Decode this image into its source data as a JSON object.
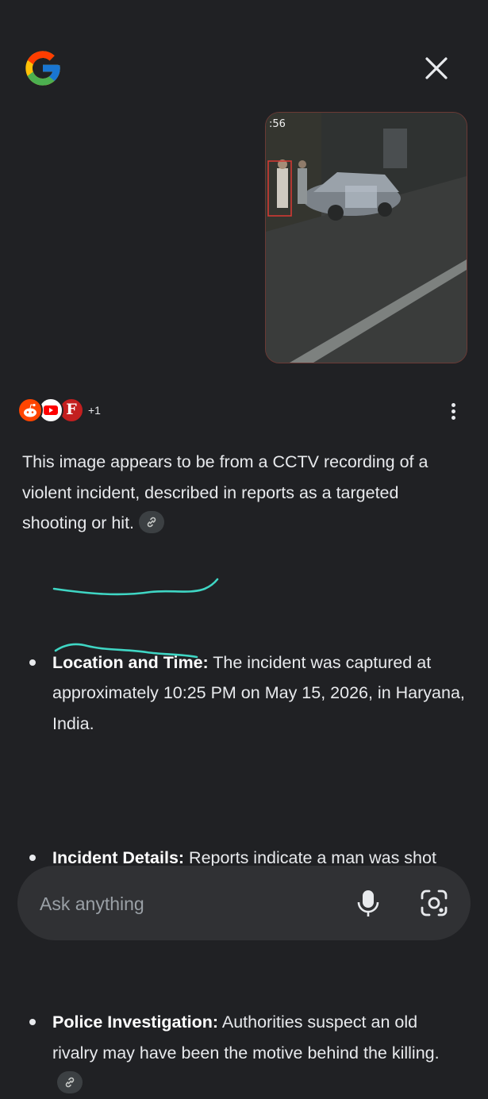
{
  "header": {
    "logo_icon": "google-g-icon",
    "close_icon": "close-icon"
  },
  "user_image": {
    "timestamp": ":56",
    "description_icon": "cctv-image"
  },
  "sources": {
    "icons": [
      "reddit-icon",
      "youtube-icon",
      "forbes-icon"
    ],
    "forbes_letter": "F",
    "more_count": "+1"
  },
  "answer": {
    "intro": "This image appears to be from a CCTV recording of a violent incident, described in reports as a targeted shooting or hit.",
    "bullets": [
      {
        "title": "Location and Time:",
        "text": " The incident was captured at approximately 10:25 PM on May 15, 2026, in Haryana, India."
      },
      {
        "title": "Incident Details:",
        "text": " Reports indicate a man was shot dead by unidentified assailants outside his home."
      },
      {
        "title": "Police Investigation:",
        "text": " Authorities suspect an old rivalry may have been the motive behind the killing."
      }
    ]
  },
  "ask_bar": {
    "placeholder": "Ask anything",
    "mic_icon": "microphone-icon",
    "lens_icon": "lens-camera-icon"
  },
  "colors": {
    "background": "#202124",
    "text": "#e8eaed",
    "annotation": "#3fd6c4",
    "chip": "#3c4043",
    "ask_bar": "#303134"
  }
}
